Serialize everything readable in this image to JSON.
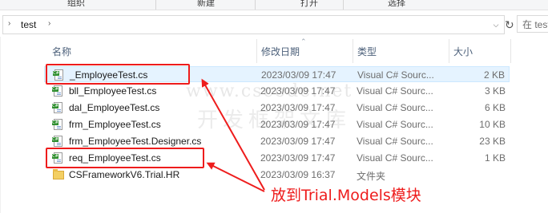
{
  "ribbon": {
    "items": [
      "组织",
      "新建",
      "打开",
      "选择"
    ]
  },
  "address": {
    "path": "test",
    "search_placeholder": "在 test"
  },
  "columns": {
    "name": "名称",
    "date": "修改日期",
    "type": "类型",
    "size": "大小"
  },
  "files": [
    {
      "name": "_EmployeeTest.cs",
      "date": "2023/03/09 17:47",
      "type": "Visual C# Sourc...",
      "size": "2 KB",
      "icon": "csharp-file-icon"
    },
    {
      "name": "bll_EmployeeTest.cs",
      "date": "2023/03/09 17:47",
      "type": "Visual C# Sourc...",
      "size": "3 KB",
      "icon": "csharp-file-icon"
    },
    {
      "name": "dal_EmployeeTest.cs",
      "date": "2023/03/09 17:47",
      "type": "Visual C# Sourc...",
      "size": "6 KB",
      "icon": "csharp-file-icon"
    },
    {
      "name": "frm_EmployeeTest.cs",
      "date": "2023/03/09 17:47",
      "type": "Visual C# Sourc...",
      "size": "10 KB",
      "icon": "csharp-file-icon"
    },
    {
      "name": "frm_EmployeeTest.Designer.cs",
      "date": "2023/03/09 17:47",
      "type": "Visual C# Sourc...",
      "size": "23 KB",
      "icon": "csharp-file-icon"
    },
    {
      "name": "req_EmployeeTest.cs",
      "date": "2023/03/09 17:47",
      "type": "Visual C# Sourc...",
      "size": "1 KB",
      "icon": "csharp-file-icon"
    },
    {
      "name": "CSFrameworkV6.Trial.HR",
      "date": "2023/03/09 16:37",
      "type": "文件夹",
      "size": "",
      "icon": "folder-icon"
    }
  ],
  "annotation": {
    "text": "放到Trial.Models模块",
    "color": "#ee1c1c"
  },
  "watermark": {
    "line1": "www.cscode.net",
    "line2": "开发框架文库"
  },
  "colors": {
    "highlight": "#ee1c1c",
    "hover_row": "#e5f3ff",
    "header_text": "#4c607a"
  }
}
